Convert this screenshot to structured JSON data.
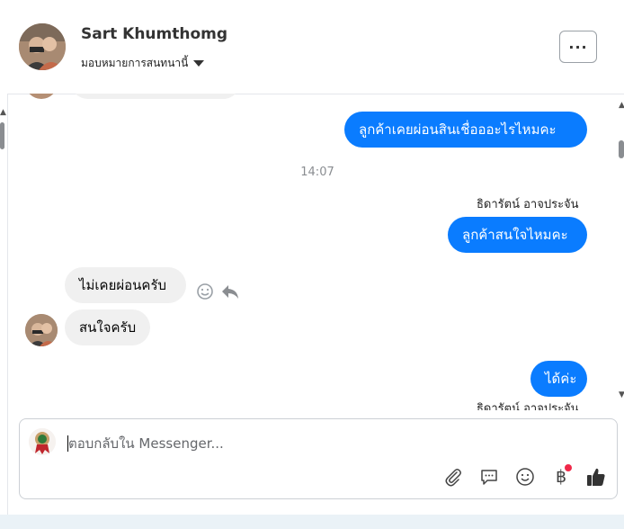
{
  "header": {
    "name": "Sart Khumthomg",
    "subtitle": "มอบหมายการสนทนานี้"
  },
  "thread": {
    "messages": [
      {
        "text": "ลูกค้าเคยผ่อนสินเชื่อออะไรไหมคะ",
        "direction": "outgoing"
      },
      {
        "timestamp": "14:07"
      },
      {
        "sender": "ธิดารัตน์ อาจประจัน"
      },
      {
        "text": "ลูกค้าสนใจไหมคะ",
        "direction": "outgoing"
      },
      {
        "text": "ไม่เคยผ่อนครับ",
        "direction": "incoming"
      },
      {
        "text": "สนใจครับ",
        "direction": "incoming"
      },
      {
        "text": "ได้ค่ะ",
        "direction": "outgoing"
      },
      {
        "sender": "ธิดารัตน์ อาจประจัน"
      }
    ]
  },
  "composer": {
    "placeholder": "ตอบกลับใน Messenger...",
    "tools": [
      "paperclip-icon",
      "speech-bubble-icon",
      "smiley-icon",
      "baht-icon",
      "thumbs-up-icon"
    ]
  },
  "colors": {
    "outgoing_bubble": "#0a7cff",
    "incoming_bubble": "#f0f0f0",
    "notification_dot": "#f02849"
  }
}
